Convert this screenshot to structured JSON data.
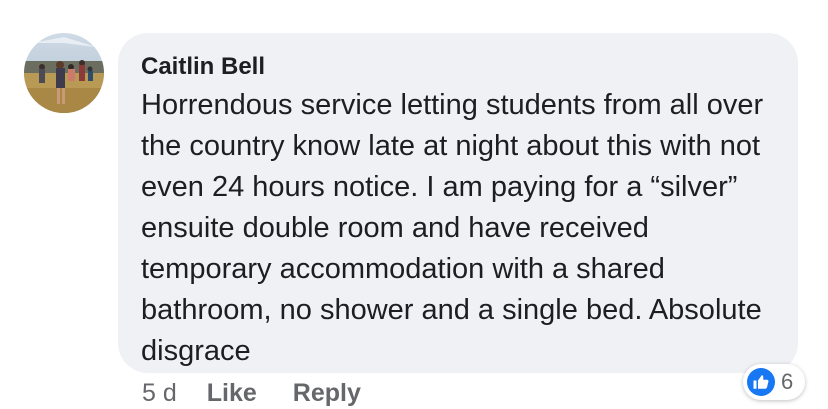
{
  "comment": {
    "author": "Caitlin Bell",
    "text": "Horrendous service letting students from all over the country know late at night about this with not even 24 hours notice. I am paying for a “silver” ensuite double room and have received temporary accommodation with a shared bathroom, no shower and a single bed. Absolute disgrace",
    "timestamp": "5 d",
    "like_label": "Like",
    "reply_label": "Reply",
    "reaction_count": "6",
    "reaction_icon": "thumbs-up-icon"
  },
  "colors": {
    "bubble_bg": "#eff1f4",
    "text": "#1c1e21",
    "meta_text": "#65676b",
    "like_blue": "#1877f2"
  }
}
